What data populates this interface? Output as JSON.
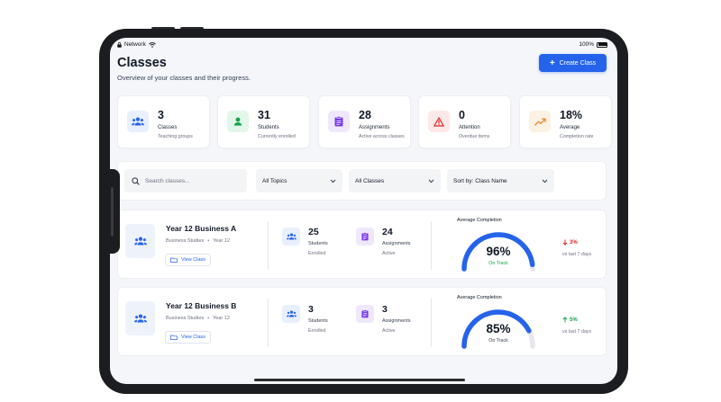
{
  "statusbar": {
    "network": "Network",
    "battery": "100%"
  },
  "header": {
    "title": "Classes",
    "subtitle": "Overview of your classes and their progress.",
    "create_label": "Create Class"
  },
  "stats": [
    {
      "value": "3",
      "label": "Classes",
      "sub": "Teaching groups",
      "icon": "users-icon",
      "color": "#2563eb",
      "bg": "#e8effd"
    },
    {
      "value": "31",
      "label": "Students",
      "sub": "Currently enrolled",
      "icon": "user-icon",
      "color": "#16a34a",
      "bg": "#e3f6ea"
    },
    {
      "value": "28",
      "label": "Assignments",
      "sub": "Active across classes",
      "icon": "clipboard-icon",
      "color": "#7c3aed",
      "bg": "#efe8fd"
    },
    {
      "value": "0",
      "label": "Attention",
      "sub": "Overdue items",
      "icon": "alert-triangle-icon",
      "color": "#dc2626",
      "bg": "#fde8e8"
    },
    {
      "value": "18%",
      "label": "Average",
      "sub": "Completion rate",
      "icon": "trending-up-icon",
      "color": "#ea8a2f",
      "bg": "#fdf1e3"
    }
  ],
  "filters": {
    "search_placeholder": "Search classes...",
    "topics": "All Topics",
    "classes": "All Classes",
    "sort": "Sort by: Class Name"
  },
  "classes": [
    {
      "name": "Year 12 Business A",
      "subject": "Business Studies",
      "year": "Year 12",
      "view_label": "View Class",
      "students": "25",
      "students_label": "Students",
      "students_sub": "Enrolled",
      "assignments": "24",
      "assignments_label": "Assignments",
      "assignments_sub": "Active",
      "gauge_title": "Average Completion",
      "completion": 96,
      "completion_label": "96%",
      "status": "On Track",
      "status_color": "#16a34a",
      "trend": "3%",
      "trend_dir": "down",
      "trend_color": "#dc2626",
      "trend_sub": "vs last 7 days"
    },
    {
      "name": "Year 12 Business B",
      "subject": "Business Studies",
      "year": "Year 12",
      "view_label": "View Class",
      "students": "3",
      "students_label": "Students",
      "students_sub": "Enrolled",
      "assignments": "3",
      "assignments_label": "Assignments",
      "assignments_sub": "Active",
      "gauge_title": "Average Completion",
      "completion": 85,
      "completion_label": "85%",
      "status": "On Track",
      "status_color": "#374151",
      "trend": "5%",
      "trend_dir": "up",
      "trend_color": "#16a34a",
      "trend_sub": "vs last 7 days"
    }
  ],
  "colors": {
    "accent": "#2563eb",
    "gauge_track": "#e5e7eb"
  }
}
